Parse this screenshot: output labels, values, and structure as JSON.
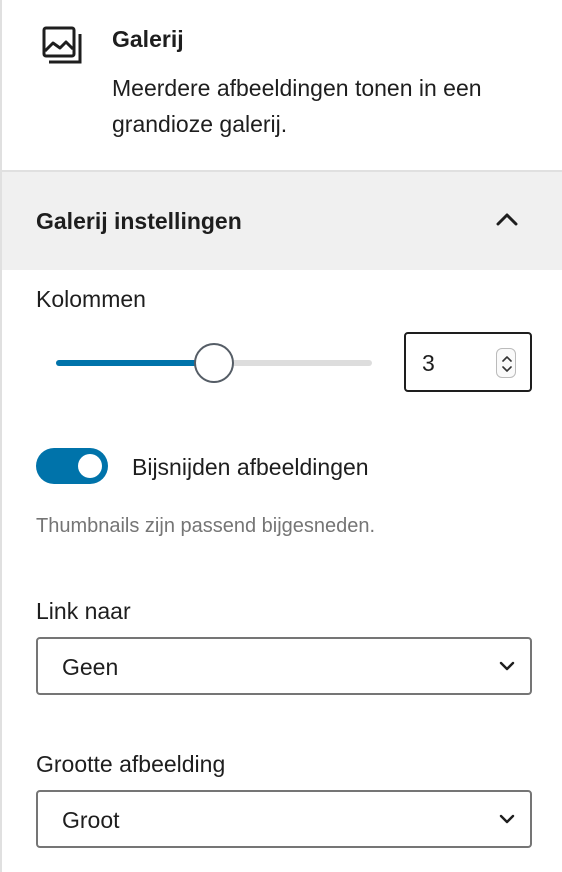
{
  "block": {
    "icon": "gallery-icon",
    "title": "Galerij",
    "description": "Meerdere afbeeldingen tonen in een grandioze galerij."
  },
  "panel": {
    "title": "Galerij instellingen",
    "toggle_icon": "chevron-up-icon"
  },
  "columns": {
    "label": "Kolommen",
    "value": "3",
    "slider_fraction": 0.5
  },
  "crop": {
    "label": "Bijsnijden afbeeldingen",
    "enabled": true,
    "help": "Thumbnails zijn passend bijgesneden."
  },
  "link_to": {
    "label": "Link naar",
    "value": "Geen"
  },
  "image_size": {
    "label": "Grootte afbeelding",
    "value": "Groot"
  },
  "colors": {
    "accent": "#0073aa",
    "header_bg": "#f0f0f0",
    "help_text": "#757575"
  }
}
